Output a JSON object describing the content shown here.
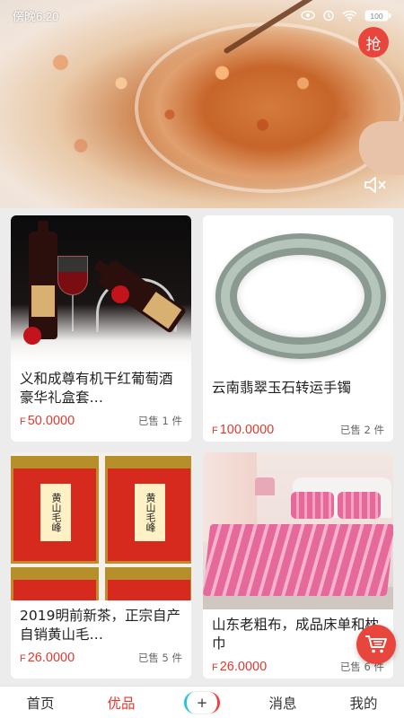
{
  "status_bar": {
    "time": "傍晚6:20",
    "battery": "100"
  },
  "banner": {
    "grab_label": "抢"
  },
  "products": [
    {
      "title": "义和成尊有机干红葡萄酒豪华礼盒套…",
      "currency": "F",
      "price": "50.0000",
      "sold": "已售 1 件"
    },
    {
      "title": "云南翡翠玉石转运手镯",
      "currency": "F",
      "price": "100.0000",
      "sold": "已售 2 件"
    },
    {
      "title": "2019明前新茶，正宗自产自销黄山毛…",
      "currency": "F",
      "price": "26.0000",
      "sold": "已售 5 件",
      "image_text": "黄山毛峰"
    },
    {
      "title": "山东老粗布，成品床单和枕巾",
      "currency": "F",
      "price": "26.0000",
      "sold": "已售 6 件"
    }
  ],
  "tabbar": {
    "home": "首页",
    "featured": "优品",
    "add": "+",
    "messages": "消息",
    "mine": "我的"
  },
  "colors": {
    "accent": "#e1382f",
    "fab": "#e8453c"
  }
}
